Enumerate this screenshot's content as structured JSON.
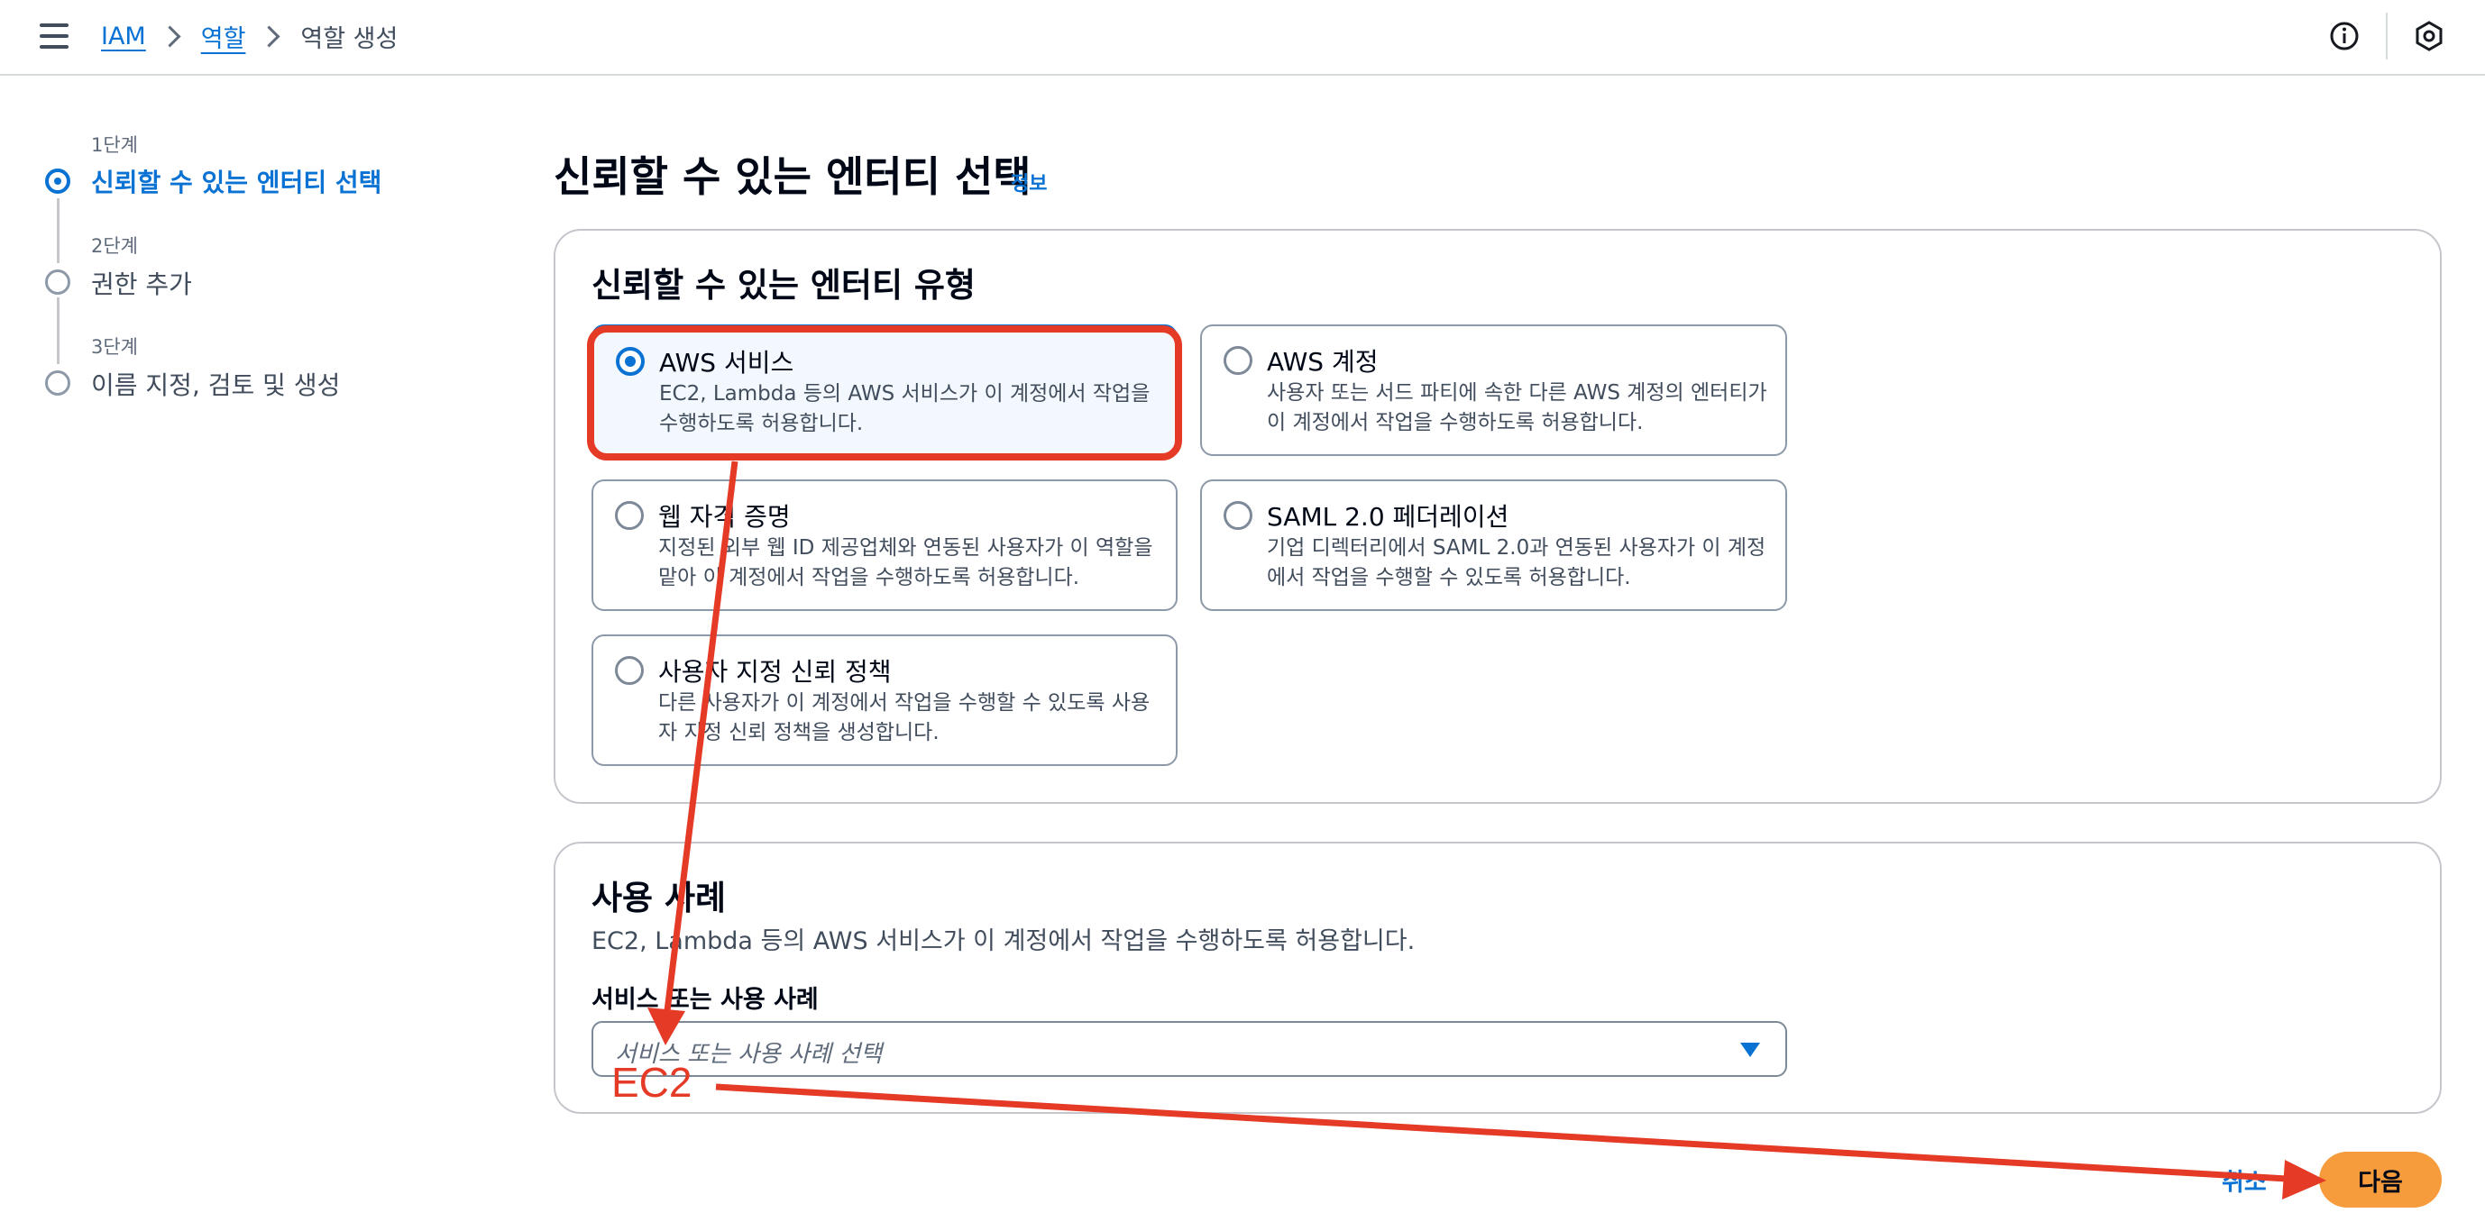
{
  "breadcrumb": {
    "items": [
      "IAM",
      "역할"
    ],
    "current": "역할 생성"
  },
  "steps": [
    {
      "number": "1단계",
      "title": "신뢰할 수 있는 엔터티 선택",
      "active": true
    },
    {
      "number": "2단계",
      "title": "권한 추가",
      "active": false
    },
    {
      "number": "3단계",
      "title": "이름 지정, 검토 및 생성",
      "active": false
    }
  ],
  "page": {
    "title": "신뢰할 수 있는 엔터티 선택",
    "info_link": "정보"
  },
  "entity_type": {
    "title": "신뢰할 수 있는 엔터티 유형",
    "options": [
      {
        "title": "AWS 서비스",
        "desc_line1": "EC2, Lambda 등의 AWS 서비스가 이 계정에서 작업을",
        "desc_line2": "수행하도록 허용합니다.",
        "selected": true
      },
      {
        "title": "AWS 계정",
        "desc_line1": "사용자 또는 서드 파티에 속한 다른 AWS 계정의 엔터티가",
        "desc_line2": "이 계정에서 작업을 수행하도록 허용합니다.",
        "selected": false
      },
      {
        "title": "웹 자격 증명",
        "desc_line1": "지정된 외부 웹 ID 제공업체와 연동된 사용자가 이 역할을",
        "desc_line2": "맡아 이 계정에서 작업을 수행하도록 허용합니다.",
        "selected": false
      },
      {
        "title": "SAML 2.0 페더레이션",
        "desc_line1": "기업 디렉터리에서 SAML 2.0과 연동된 사용자가 이 계정",
        "desc_line2": "에서 작업을 수행할 수 있도록 허용합니다.",
        "selected": false
      },
      {
        "title": "사용자 지정 신뢰 정책",
        "desc_line1": "다른 사용자가 이 계정에서 작업을 수행할 수 있도록 사용",
        "desc_line2": "자 지정 신뢰 정책을 생성합니다.",
        "selected": false
      }
    ]
  },
  "use_case": {
    "title": "사용 사례",
    "description": "EC2, Lambda 등의 AWS 서비스가 이 계정에서 작업을 수행하도록 허용합니다.",
    "field_label": "서비스 또는 사용 사례",
    "select_placeholder": "서비스 또는 사용 사례 선택"
  },
  "footer": {
    "cancel": "취소",
    "next": "다음"
  },
  "annotation": {
    "text": "EC2",
    "color": "#e53a26"
  },
  "colors": {
    "primary": "#0972d3",
    "next_button": "#f79c3c",
    "annotation": "#e53a26"
  }
}
